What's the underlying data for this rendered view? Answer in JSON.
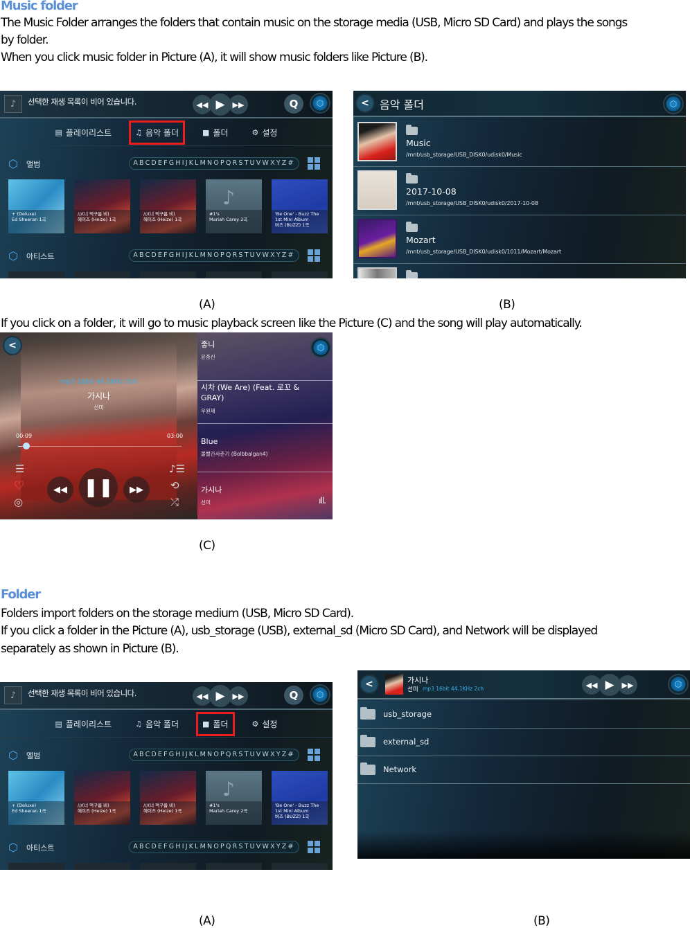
{
  "section1": {
    "heading": "Music folder",
    "para1_line1": "The Music Folder arranges the folders that contain music on the storage media (USB, Micro SD Card) and plays the songs",
    "para1_line2": "by folder.",
    "para2": "When you click music folder in Picture (A), it will show music folders like Picture (B).",
    "caption_a": "(A)",
    "caption_b": "(B)",
    "para3": "If you click on a folder, it will go to music playback screen like the Picture (C) and the song will play automatically.",
    "caption_c": "(C)"
  },
  "section2": {
    "heading": "Folder",
    "para1": "Folders import folders on the storage medium (USB, Micro SD Card).",
    "para2_line1": "If you click a folder in the Picture (A), usb_storage (USB), external_sd (Micro SD Card), and Network will be displayed",
    "para2_line2": "separately as shown in Picture (B).",
    "caption_a": "(A)",
    "caption_b": "(B)"
  },
  "home_screen": {
    "status_text": "선택한 재생 목록이 비어 있습니다.",
    "icons": {
      "prev": "◀◀",
      "play": "▶",
      "next": "▶▶",
      "search": "Q",
      "brand": "⬡"
    },
    "tabs": [
      {
        "label": "플레이리스트",
        "icon": "playlist-icon"
      },
      {
        "label": "음악 폴더",
        "icon": "music-folder-icon"
      },
      {
        "label": "폴더",
        "icon": "folder-icon"
      },
      {
        "label": "설정",
        "icon": "gear-icon"
      }
    ],
    "album_section": "앨범",
    "artist_section": "아티스트",
    "alphabet": "ABCDEFGHIJKLMNOPQRSTUVWXYZ#",
    "albums": [
      {
        "title": "+ (Deluxe)",
        "sub": "Ed Sheeran 1곡"
      },
      {
        "title": "///(너 먹구름 비)",
        "sub": "헤이즈 (Heize) 1곡"
      },
      {
        "title": "///(너 먹구름 비)",
        "sub": "헤이즈 (Heize) 1곡"
      },
      {
        "title": "#1's",
        "sub": "Mariah Carey 2곡"
      },
      {
        "title": "'Be One' - Buzz The 1st Mini Album",
        "sub": "버즈 (BUZZ) 1곡"
      }
    ]
  },
  "screen_a1": {
    "selected_tab": 1,
    "highlight_color": "#ee1c1c"
  },
  "screen_a2": {
    "selected_tab": 2,
    "highlight_color": "#ee1c1c"
  },
  "music_folder_screen": {
    "title": "음악 폴더",
    "folders": [
      {
        "name": "Music",
        "path": "/mnt/usb_storage/USB_DISK0/udisk0/Music"
      },
      {
        "name": "2017-10-08",
        "path": "/mnt/usb_storage/USB_DISK0/udisk0/2017-10-08"
      },
      {
        "name": "Mozart",
        "path": "/mnt/usb_storage/USB_DISK0/udisk0/1011/Mozart/Mozart"
      }
    ]
  },
  "playback_screen": {
    "format": "mp3 16bit 44.1KHz 2ch",
    "title": "가시나",
    "artist": "선미",
    "elapsed": "00:09",
    "duration": "03:00",
    "progress": 0.05,
    "queue": [
      {
        "title": "좋니",
        "artist": "윤종신"
      },
      {
        "title": "시차 (We Are) (Feat. 로꼬 & GRAY)",
        "artist": "우원재"
      },
      {
        "title": "Blue",
        "artist": "볼빨간사춘기 (Bolbbalgan4)"
      },
      {
        "title": "가시나",
        "artist": "선미",
        "now_playing": true
      }
    ],
    "accent_color": "#3ab0ea"
  },
  "folder_screen": {
    "now_playing_title": "가시나",
    "now_playing_artist": "선미",
    "now_playing_format": "mp3 16bit 44.1KHz 2ch",
    "folders": [
      "usb_storage",
      "external_sd",
      "Network"
    ]
  }
}
